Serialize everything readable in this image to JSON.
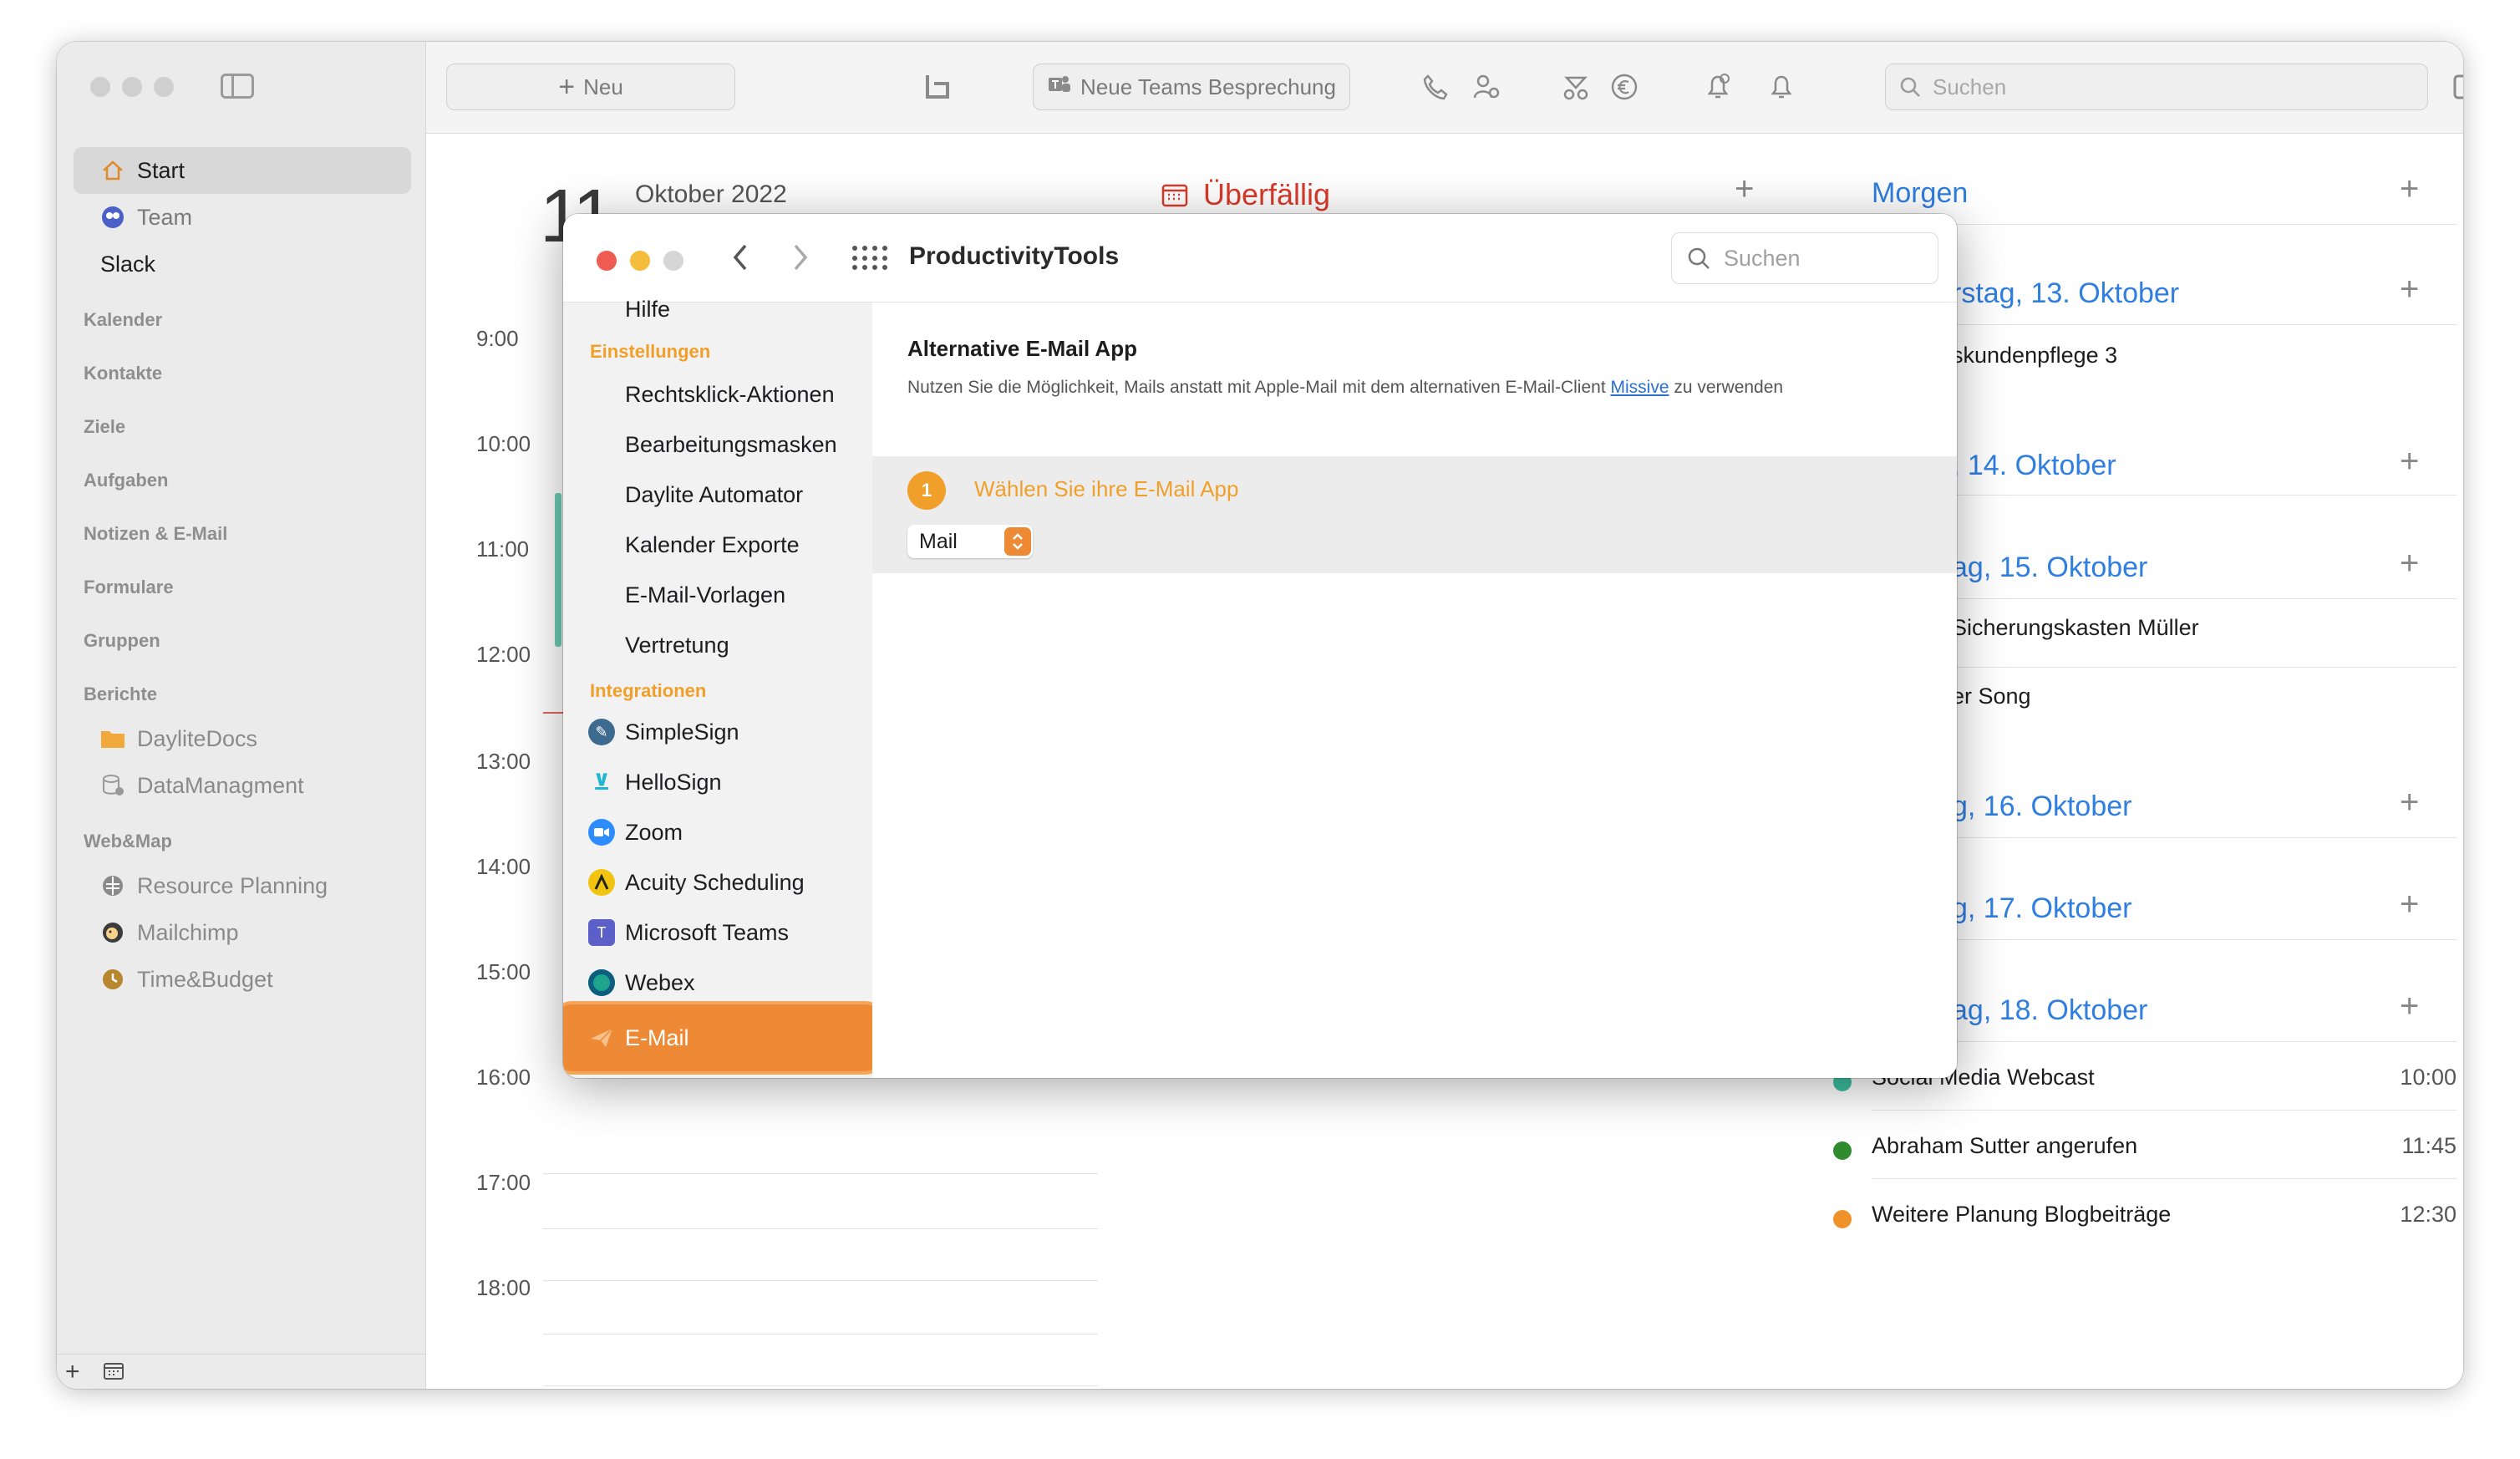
{
  "sidebar": {
    "items": [
      {
        "label": "Start",
        "icon": "house-icon"
      },
      {
        "label": "Team",
        "icon": "team-icon"
      },
      {
        "label": "Slack",
        "icon": ""
      }
    ],
    "sections": [
      "Kalender",
      "Kontakte",
      "Ziele",
      "Aufgaben",
      "Notizen & E-Mail",
      "Formulare",
      "Gruppen",
      "Berichte"
    ],
    "reports": [
      {
        "label": "DayliteDocs",
        "icon": "folder-icon"
      },
      {
        "label": "DataManagment",
        "icon": "database-icon"
      }
    ],
    "web_header": "Web&Map",
    "web": [
      {
        "label": "Resource Planning",
        "icon": "globe-icon"
      },
      {
        "label": "Mailchimp",
        "icon": "mailchimp-icon"
      },
      {
        "label": "Time&Budget",
        "icon": "clock-icon"
      }
    ]
  },
  "toolbar": {
    "new_label": "Neu",
    "teams_label": "Neue Teams Besprechung",
    "search_placeholder": "Suchen"
  },
  "calendar": {
    "day_number": "11",
    "month": "Oktober 2022",
    "hours": [
      "9:00",
      "10:00",
      "11:00",
      "12:00",
      "13:00",
      "14:00",
      "15:00",
      "16:00",
      "17:00",
      "18:00"
    ]
  },
  "overdue": {
    "title": "Überfällig"
  },
  "upcoming": {
    "morgen": "Morgen",
    "days": [
      {
        "label": "rstag, 13. Oktober"
      },
      {
        "label": ", 14. Oktober"
      },
      {
        "label": "ag, 15. Oktober"
      },
      {
        "label": "g, 16. Oktober"
      },
      {
        "label": "g, 17. Oktober"
      },
      {
        "label": "ag, 18. Oktober"
      }
    ],
    "items": {
      "kundenpflege": "skundenpflege 3",
      "sicherung": "Sicherungskasten Müller",
      "song": "er Song",
      "webcast": "Social Media Webcast",
      "webcast_time": "10:00",
      "abraham": "Abraham Sutter angerufen",
      "abraham_time": "11:45",
      "planung": "Weitere Planung Blogbeiträge",
      "planung_time": "12:30"
    },
    "colors": {
      "green": "#2e8b2e",
      "orange": "#f0922a",
      "teal": "#3cc0a0"
    }
  },
  "modal": {
    "title": "ProductivityTools",
    "search_placeholder": "Suchen",
    "hilfe": "Hilfe",
    "settings_header": "Einstellungen",
    "settings": [
      "Rechtsklick-Aktionen",
      "Bearbeitungsmasken",
      "Daylite Automator",
      "Kalender Exporte",
      "E-Mail-Vorlagen",
      "Vertretung"
    ],
    "integrations_header": "Integrationen",
    "integrations": [
      {
        "label": "SimpleSign",
        "icon": "simplesign-icon",
        "color": "#3d6b8f"
      },
      {
        "label": "HelloSign",
        "icon": "hellosign-icon",
        "color": "#1fb5d4"
      },
      {
        "label": "Zoom",
        "icon": "zoom-icon",
        "color": "#2d8cff"
      },
      {
        "label": "Acuity Scheduling",
        "icon": "acuity-icon",
        "color": "#f1c40f"
      },
      {
        "label": "Microsoft Teams",
        "icon": "teams-icon",
        "color": "#5b5fc7"
      },
      {
        "label": "Webex",
        "icon": "webex-icon",
        "color": "#1ea38f"
      },
      {
        "label": "E-Mail",
        "icon": "paper-plane-icon",
        "color": "#ffffff"
      }
    ],
    "content": {
      "title": "Alternative E-Mail App",
      "desc_before": "Nutzen Sie die Möglichkeit, Mails anstatt mit Apple-Mail mit dem alternativen E-Mail-Client ",
      "desc_link": "Missive",
      "desc_after": " zu verwenden",
      "step_number": "1",
      "step_label": "Wählen Sie ihre E-Mail App",
      "select_value": "Mail"
    }
  }
}
